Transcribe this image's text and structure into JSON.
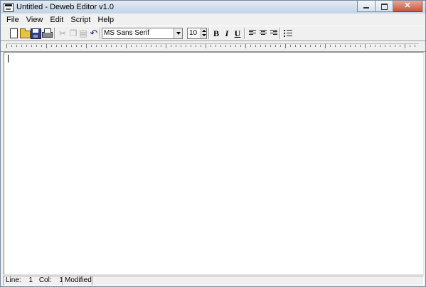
{
  "window": {
    "title": "Untitled - Deweb Editor v1.0",
    "icon": "app-document-icon",
    "controls": {
      "close_label": "✕"
    }
  },
  "menu": [
    "File",
    "View",
    "Edit",
    "Script",
    "Help"
  ],
  "toolbar": {
    "file_buttons": [
      {
        "name": "new-file",
        "icon": "new-document-icon"
      },
      {
        "name": "open-file",
        "icon": "open-folder-icon"
      },
      {
        "name": "save-file",
        "icon": "floppy-disk-icon"
      },
      {
        "name": "print",
        "icon": "printer-icon"
      }
    ],
    "edit_buttons": [
      {
        "name": "cut",
        "icon": "scissors-icon",
        "enabled": false
      },
      {
        "name": "copy",
        "icon": "copy-icon",
        "enabled": false
      },
      {
        "name": "paste",
        "icon": "paste-icon",
        "enabled": false
      },
      {
        "name": "undo",
        "icon": "undo-icon",
        "enabled": true
      }
    ],
    "font_name": "MS Sans Serif",
    "font_size": "10",
    "format_labels": {
      "bold": "B",
      "italic": "I",
      "underline": "U"
    },
    "align_buttons": [
      "align-left-icon",
      "align-center-icon",
      "align-right-icon"
    ],
    "bullets_icon": "bullet-list-icon"
  },
  "editor": {
    "content": ""
  },
  "status": {
    "line_label": "Line:",
    "line_value": "1",
    "col_label": "Col:",
    "col_value": "1",
    "modified": "Modified"
  },
  "colors": {
    "titlebar": "#cfdceb",
    "close_button": "#c7543b",
    "editor_bg": "#ffffff",
    "chrome": "#f0f0f0"
  }
}
